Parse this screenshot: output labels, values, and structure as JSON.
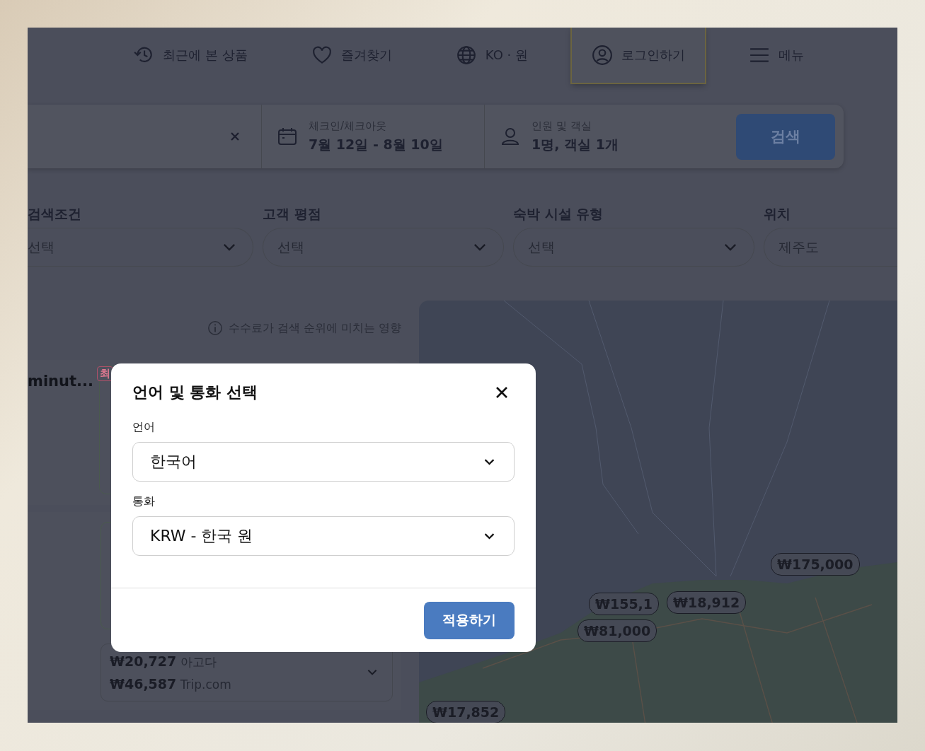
{
  "header": {
    "nav": [
      {
        "kind": "history",
        "label": "최근에 본 상품",
        "focused": false
      },
      {
        "kind": "heart",
        "label": "즐겨찾기",
        "focused": false
      },
      {
        "kind": "globe",
        "label": "KO · 원",
        "focused": false
      },
      {
        "kind": "user",
        "label": "로그인하기",
        "focused": true
      },
      {
        "kind": "menu",
        "label": "메뉴",
        "focused": false
      }
    ]
  },
  "search": {
    "dates": {
      "label": "체크인/체크아웃",
      "value": "7월 12일 - 8월 10일"
    },
    "guests": {
      "label": "인원 및 객실",
      "value": "1명, 객실 1개"
    },
    "button": "검색"
  },
  "filters": [
    {
      "label": "검색조건",
      "value": "선택"
    },
    {
      "label": "고객 평점",
      "value": "선택"
    },
    {
      "label": "숙박 시설 유형",
      "value": "선택"
    },
    {
      "label": "위치",
      "value": "제주도"
    }
  ],
  "fee_notice": "수수료가 검색 순위에 미치는 영향",
  "results": {
    "title": "minut...",
    "badge": "최",
    "offers": [
      {
        "price": "₩20,727",
        "site": "아고다"
      },
      {
        "price": "₩46,587",
        "site": "Trip.com"
      }
    ]
  },
  "map": {
    "pins": [
      {
        "label": "₩175,000"
      },
      {
        "label": "₩155,1"
      },
      {
        "label": "₩18,912"
      },
      {
        "label": "₩81,000"
      },
      {
        "label": "₩17,852"
      }
    ]
  },
  "modal": {
    "title": "언어 및 통화 선택",
    "fields": [
      {
        "label": "언어",
        "value": "한국어"
      },
      {
        "label": "통화",
        "value": "KRW - 한국 원"
      }
    ],
    "apply": "적용하기"
  }
}
